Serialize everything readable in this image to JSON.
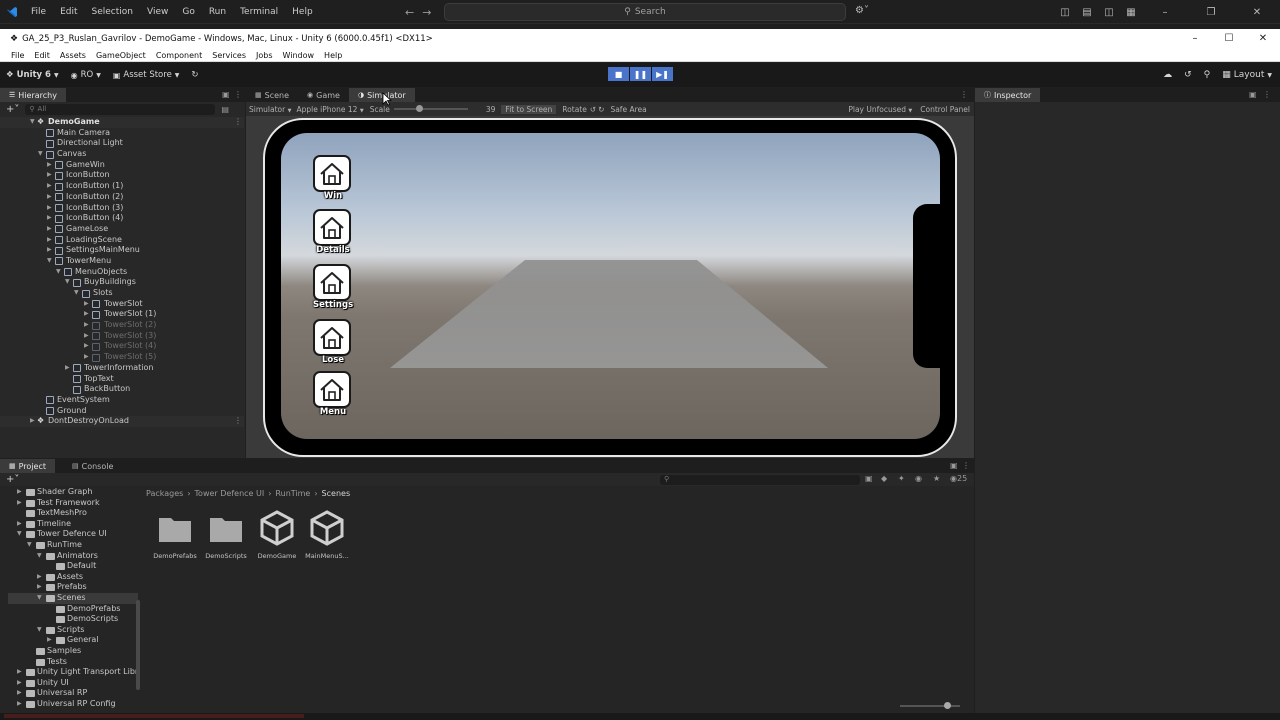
{
  "vscode": {
    "menu": [
      "File",
      "Edit",
      "Selection",
      "View",
      "Go",
      "Run",
      "Terminal",
      "Help"
    ],
    "search_label": "Search"
  },
  "unity_window": {
    "title": "GA_25_P3_Ruslan_Gavrilov - DemoGame - Windows, Mac, Linux - Unity 6 (6000.0.45f1) <DX11>",
    "menu": [
      "File",
      "Edit",
      "Assets",
      "GameObject",
      "Component",
      "Services",
      "Jobs",
      "Window",
      "Help"
    ]
  },
  "toolbar": {
    "unity_label": "Unity 6",
    "account_label": "RO",
    "asset_store_label": "Asset Store",
    "layout_label": "Layout"
  },
  "hierarchy": {
    "tab_label": "Hierarchy",
    "search_placeholder": "All",
    "scene_name": "DemoGame",
    "items": [
      {
        "label": "Main Camera"
      },
      {
        "label": "Directional Light"
      },
      {
        "label": "Canvas"
      },
      {
        "label": "GameWin"
      },
      {
        "label": "IconButton"
      },
      {
        "label": "IconButton (1)"
      },
      {
        "label": "IconButton (2)"
      },
      {
        "label": "IconButton (3)"
      },
      {
        "label": "IconButton (4)"
      },
      {
        "label": "GameLose"
      },
      {
        "label": "LoadingScene"
      },
      {
        "label": "SettingsMainMenu"
      },
      {
        "label": "TowerMenu"
      },
      {
        "label": "MenuObjects"
      },
      {
        "label": "BuyBuildings"
      },
      {
        "label": "Slots"
      },
      {
        "label": "TowerSlot"
      },
      {
        "label": "TowerSlot (1)"
      },
      {
        "label": "TowerSlot (2)"
      },
      {
        "label": "TowerSlot (3)"
      },
      {
        "label": "TowerSlot (4)"
      },
      {
        "label": "TowerSlot (5)"
      },
      {
        "label": "TowerInformation"
      },
      {
        "label": "TopText"
      },
      {
        "label": "BackButton"
      },
      {
        "label": "EventSystem"
      },
      {
        "label": "Ground"
      }
    ],
    "dont_destroy_label": "DontDestroyOnLoad"
  },
  "viewport": {
    "tabs": [
      "Scene",
      "Game",
      "Simulator"
    ],
    "simulator_dropdown": "Simulator",
    "device_dropdown": "Apple iPhone 12",
    "scale_label": "Scale",
    "scale_value": "39",
    "fit_to_screen": "Fit to Screen",
    "rotate_label": "Rotate",
    "safe_area_label": "Safe Area",
    "play_focus": "Play Unfocused",
    "control_panel": "Control Panel",
    "buttons": [
      {
        "caption": "Win"
      },
      {
        "caption": "Details"
      },
      {
        "caption": "Settings"
      },
      {
        "caption": "Lose"
      },
      {
        "caption": "Menu"
      }
    ]
  },
  "inspector": {
    "tab_label": "Inspector"
  },
  "project": {
    "tabs": [
      "Project",
      "Console"
    ],
    "breadcrumb": [
      "Packages",
      "Tower Defence UI",
      "RunTime",
      "Scenes"
    ],
    "hidden_count": "25",
    "tree": [
      {
        "label": "Shader Graph"
      },
      {
        "label": "Test Framework"
      },
      {
        "label": "TextMeshPro"
      },
      {
        "label": "Timeline"
      },
      {
        "label": "Tower Defence UI"
      },
      {
        "label": "RunTime"
      },
      {
        "label": "Animators"
      },
      {
        "label": "Default"
      },
      {
        "label": "Assets"
      },
      {
        "label": "Prefabs"
      },
      {
        "label": "Scenes"
      },
      {
        "label": "DemoPrefabs"
      },
      {
        "label": "DemoScripts"
      },
      {
        "label": "Scripts"
      },
      {
        "label": "General"
      },
      {
        "label": "Samples"
      },
      {
        "label": "Tests"
      },
      {
        "label": "Unity Light Transport Libr"
      },
      {
        "label": "Unity UI"
      },
      {
        "label": "Universal RP"
      },
      {
        "label": "Universal RP Config"
      }
    ],
    "assets": [
      {
        "label": "DemoPrefabs",
        "kind": "folder"
      },
      {
        "label": "DemoScripts",
        "kind": "folder"
      },
      {
        "label": "DemoGame",
        "kind": "scene"
      },
      {
        "label": "MainMenuS...",
        "kind": "scene"
      }
    ]
  },
  "colors": {
    "play_active": "#4a74c9",
    "panel_bg": "#282828",
    "toolbar_bg": "#191919"
  }
}
